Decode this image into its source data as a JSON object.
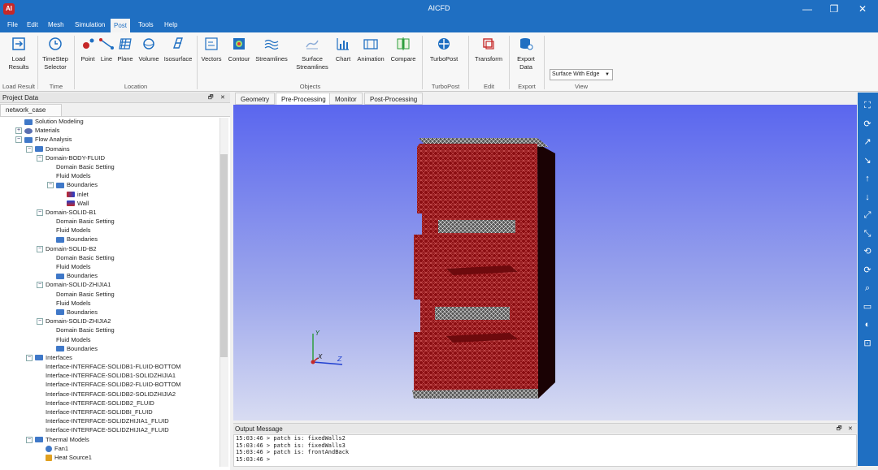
{
  "window": {
    "title": "AICFD",
    "logo": "AI",
    "minimize": "—",
    "maximize": "❐",
    "close": "✕"
  },
  "menu": [
    "File",
    "Edit",
    "Mesh",
    "Simulation",
    "Post",
    "Tools",
    "Help"
  ],
  "menu_active": "Post",
  "ribbon": {
    "buttons": [
      {
        "label": "Load\nResults",
        "icon": "load-results-icon"
      },
      {
        "label": "TimeStep\nSelector",
        "icon": "clock-icon"
      },
      {
        "label": "Point",
        "icon": "point-icon"
      },
      {
        "label": "Line",
        "icon": "line-icon"
      },
      {
        "label": "Plane",
        "icon": "plane-icon"
      },
      {
        "label": "Volume",
        "icon": "volume-icon"
      },
      {
        "label": "Isosurface",
        "icon": "isosurface-icon"
      },
      {
        "label": "Vectors",
        "icon": "vectors-icon"
      },
      {
        "label": "Contour",
        "icon": "contour-icon"
      },
      {
        "label": "Streamlines",
        "icon": "streamlines-icon"
      },
      {
        "label": "Surface\nStreamlines",
        "icon": "surface-streamlines-icon"
      },
      {
        "label": "Chart",
        "icon": "chart-icon"
      },
      {
        "label": "Animation",
        "icon": "animation-icon"
      },
      {
        "label": "Compare",
        "icon": "compare-icon"
      },
      {
        "label": "TurboPost",
        "icon": "turbopost-icon"
      },
      {
        "label": "Transform",
        "icon": "transform-icon"
      },
      {
        "label": "Export\nData",
        "icon": "export-data-icon"
      }
    ],
    "groups": [
      "Load Result",
      "Time",
      "Location",
      "Objects",
      "TurboPost",
      "Edit",
      "Export",
      "View"
    ],
    "view_select": {
      "value": "Surface With Edge",
      "arrow": "▼"
    }
  },
  "project": {
    "header": "Project Data",
    "pin": "🗗",
    "close": "✕",
    "tab": "network_case",
    "tree": [
      {
        "label": "Solution Modeling",
        "depth": 1,
        "kind": "folder",
        "exp": ""
      },
      {
        "label": "Materials",
        "depth": 1,
        "kind": "materials",
        "exp": "+"
      },
      {
        "label": "Flow Analysis",
        "depth": 1,
        "kind": "folder",
        "exp": "−"
      },
      {
        "label": "Domains",
        "depth": 2,
        "kind": "folder",
        "exp": "−"
      },
      {
        "label": "Domain-BODY-FLUID",
        "depth": 3,
        "kind": "text",
        "exp": "−"
      },
      {
        "label": "Domain Basic Setting",
        "depth": 4,
        "kind": "text",
        "exp": ""
      },
      {
        "label": "Fluid Models",
        "depth": 4,
        "kind": "text",
        "exp": ""
      },
      {
        "label": "Boundaries",
        "depth": 4,
        "kind": "folder",
        "exp": "−"
      },
      {
        "label": "inlet",
        "depth": 5,
        "kind": "inlet",
        "exp": ""
      },
      {
        "label": "Wall",
        "depth": 5,
        "kind": "wall",
        "exp": ""
      },
      {
        "label": "Domain-SOLID-B1",
        "depth": 3,
        "kind": "text",
        "exp": "−"
      },
      {
        "label": "Domain Basic Setting",
        "depth": 4,
        "kind": "text",
        "exp": ""
      },
      {
        "label": "Fluid Models",
        "depth": 4,
        "kind": "text",
        "exp": ""
      },
      {
        "label": "Boundaries",
        "depth": 4,
        "kind": "folder",
        "exp": ""
      },
      {
        "label": "Domain-SOLID-B2",
        "depth": 3,
        "kind": "text",
        "exp": "−"
      },
      {
        "label": "Domain Basic Setting",
        "depth": 4,
        "kind": "text",
        "exp": ""
      },
      {
        "label": "Fluid Models",
        "depth": 4,
        "kind": "text",
        "exp": ""
      },
      {
        "label": "Boundaries",
        "depth": 4,
        "kind": "folder",
        "exp": ""
      },
      {
        "label": "Domain-SOLID-ZHIJIA1",
        "depth": 3,
        "kind": "text",
        "exp": "−"
      },
      {
        "label": "Domain Basic Setting",
        "depth": 4,
        "kind": "text",
        "exp": ""
      },
      {
        "label": "Fluid Models",
        "depth": 4,
        "kind": "text",
        "exp": ""
      },
      {
        "label": "Boundaries",
        "depth": 4,
        "kind": "folder",
        "exp": ""
      },
      {
        "label": "Domain-SOLID-ZHIJIA2",
        "depth": 3,
        "kind": "text",
        "exp": "−"
      },
      {
        "label": "Domain Basic Setting",
        "depth": 4,
        "kind": "text",
        "exp": ""
      },
      {
        "label": "Fluid Models",
        "depth": 4,
        "kind": "text",
        "exp": ""
      },
      {
        "label": "Boundaries",
        "depth": 4,
        "kind": "folder",
        "exp": ""
      },
      {
        "label": "Interfaces",
        "depth": 2,
        "kind": "folder",
        "exp": "−"
      },
      {
        "label": "Interface-INTERFACE-SOLIDB1-FLUID-BOTTOM",
        "depth": 3,
        "kind": "text",
        "exp": ""
      },
      {
        "label": "Interface-INTERFACE-SOLIDB1-SOLIDZHIJIA1",
        "depth": 3,
        "kind": "text",
        "exp": ""
      },
      {
        "label": "Interface-INTERFACE-SOLIDB2-FLUID-BOTTOM",
        "depth": 3,
        "kind": "text",
        "exp": ""
      },
      {
        "label": "Interface-INTERFACE-SOLIDB2-SOLIDZHIJIA2",
        "depth": 3,
        "kind": "text",
        "exp": ""
      },
      {
        "label": "Interface-INTERFACE-SOLIDB2_FLUID",
        "depth": 3,
        "kind": "text",
        "exp": ""
      },
      {
        "label": "Interface-INTERFACE-SOLIDBI_FLUID",
        "depth": 3,
        "kind": "text",
        "exp": ""
      },
      {
        "label": "Interface-INTERFACE-SOLIDZHIJIA1_FLUID",
        "depth": 3,
        "kind": "text",
        "exp": ""
      },
      {
        "label": "Interface-INTERFACE-SOLIDZHIJIA2_FLUID",
        "depth": 3,
        "kind": "text",
        "exp": ""
      },
      {
        "label": "Thermal Models",
        "depth": 2,
        "kind": "folder",
        "exp": "−"
      },
      {
        "label": "Fan1",
        "depth": 3,
        "kind": "fan",
        "exp": ""
      },
      {
        "label": "Heat Source1",
        "depth": 3,
        "kind": "heat",
        "exp": ""
      }
    ]
  },
  "viewport_tabs": [
    "Geometry",
    "Pre-Processing",
    "Monitor",
    "Post-Processing"
  ],
  "viewport_active_tab": "Pre-Processing",
  "axes": {
    "x": "X",
    "y": "Y",
    "z": "Z"
  },
  "colors": {
    "accent": "#1f6fc2",
    "mesh": "#8b0e12",
    "mesh_dark": "#2a0305"
  },
  "output": {
    "header": "Output Message",
    "pin": "🗗",
    "close": "✕",
    "lines": [
      "15:03:46 > patch is: fixedWalls2",
      "15:03:46 > patch is: fixedWalls3",
      "15:03:46 > patch is: frontAndBack",
      "15:03:46 >"
    ]
  },
  "right_toolbar": [
    "fit-view-icon",
    "rotate-icon",
    "view-x-pos-icon",
    "view-x-neg-icon",
    "view-y-pos-icon",
    "view-y-neg-icon",
    "view-z-pos-icon",
    "view-z-neg-icon",
    "rotate-90-cw-icon",
    "rotate-90-ccw-icon",
    "zoom-region-icon",
    "ruler-icon",
    "palette-icon",
    "camera-icon"
  ]
}
